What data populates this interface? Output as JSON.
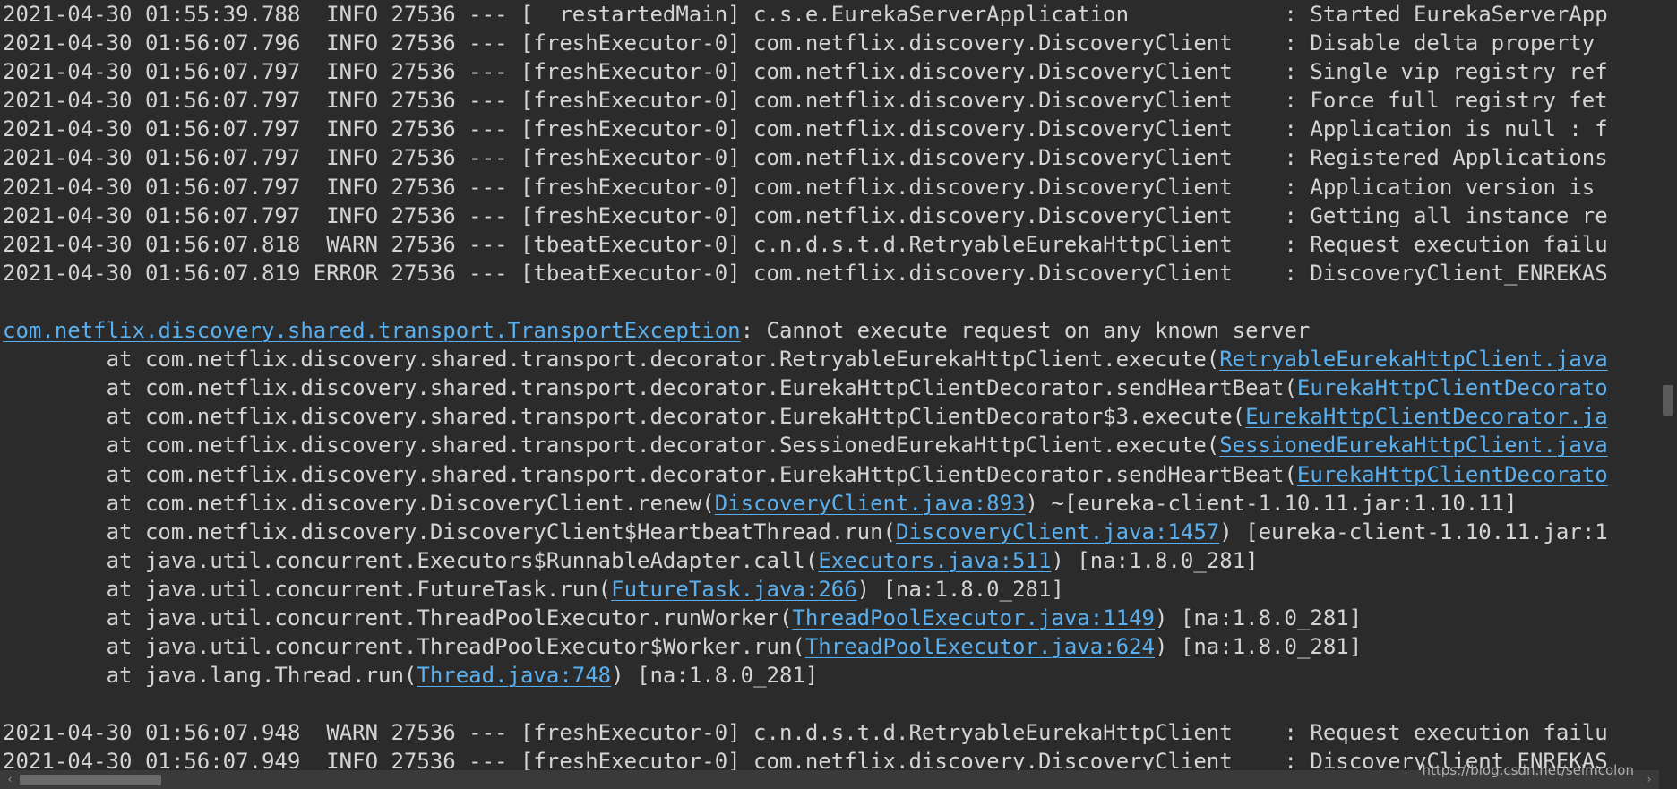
{
  "theme": {
    "background": "#2b2b2b",
    "text": "#d4d4d4",
    "link": "#5ab0ef"
  },
  "console": {
    "lines": [
      [
        {
          "t": "2021-04-30 01:55:39.788  INFO 27536 --- [  restartedMain] c.s.e.EurekaServerApplication            : Started EurekaServerApp"
        }
      ],
      [
        {
          "t": "2021-04-30 01:56:07.796  INFO 27536 --- [freshExecutor-0] com.netflix.discovery.DiscoveryClient    : Disable delta property"
        }
      ],
      [
        {
          "t": "2021-04-30 01:56:07.797  INFO 27536 --- [freshExecutor-0] com.netflix.discovery.DiscoveryClient    : Single vip registry ref"
        }
      ],
      [
        {
          "t": "2021-04-30 01:56:07.797  INFO 27536 --- [freshExecutor-0] com.netflix.discovery.DiscoveryClient    : Force full registry fet"
        }
      ],
      [
        {
          "t": "2021-04-30 01:56:07.797  INFO 27536 --- [freshExecutor-0] com.netflix.discovery.DiscoveryClient    : Application is null : f"
        }
      ],
      [
        {
          "t": "2021-04-30 01:56:07.797  INFO 27536 --- [freshExecutor-0] com.netflix.discovery.DiscoveryClient    : Registered Applications"
        }
      ],
      [
        {
          "t": "2021-04-30 01:56:07.797  INFO 27536 --- [freshExecutor-0] com.netflix.discovery.DiscoveryClient    : Application version is"
        }
      ],
      [
        {
          "t": "2021-04-30 01:56:07.797  INFO 27536 --- [freshExecutor-0] com.netflix.discovery.DiscoveryClient    : Getting all instance re"
        }
      ],
      [
        {
          "t": "2021-04-30 01:56:07.818  WARN 27536 --- [tbeatExecutor-0] c.n.d.s.t.d.RetryableEurekaHttpClient    : Request execution failu"
        }
      ],
      [
        {
          "t": "2021-04-30 01:56:07.819 ERROR 27536 --- [tbeatExecutor-0] com.netflix.discovery.DiscoveryClient    : DiscoveryClient_ENREKAS"
        }
      ],
      [
        {
          "t": ""
        }
      ],
      [
        {
          "t": "com.netflix.discovery.shared.transport.TransportException",
          "link": true
        },
        {
          "t": ": Cannot execute request on any known server"
        }
      ],
      [
        {
          "t": "        at com.netflix.discovery.shared.transport.decorator.RetryableEurekaHttpClient.execute("
        },
        {
          "t": "RetryableEurekaHttpClient.java",
          "link": true
        }
      ],
      [
        {
          "t": "        at com.netflix.discovery.shared.transport.decorator.EurekaHttpClientDecorator.sendHeartBeat("
        },
        {
          "t": "EurekaHttpClientDecorato",
          "link": true
        }
      ],
      [
        {
          "t": "        at com.netflix.discovery.shared.transport.decorator.EurekaHttpClientDecorator$3.execute("
        },
        {
          "t": "EurekaHttpClientDecorator.ja",
          "link": true
        }
      ],
      [
        {
          "t": "        at com.netflix.discovery.shared.transport.decorator.SessionedEurekaHttpClient.execute("
        },
        {
          "t": "SessionedEurekaHttpClient.java",
          "link": true
        }
      ],
      [
        {
          "t": "        at com.netflix.discovery.shared.transport.decorator.EurekaHttpClientDecorator.sendHeartBeat("
        },
        {
          "t": "EurekaHttpClientDecorato",
          "link": true
        }
      ],
      [
        {
          "t": "        at com.netflix.discovery.DiscoveryClient.renew("
        },
        {
          "t": "DiscoveryClient.java:893",
          "link": true
        },
        {
          "t": ") ~[eureka-client-1.10.11.jar:1.10.11]"
        }
      ],
      [
        {
          "t": "        at com.netflix.discovery.DiscoveryClient$HeartbeatThread.run("
        },
        {
          "t": "DiscoveryClient.java:1457",
          "link": true
        },
        {
          "t": ") [eureka-client-1.10.11.jar:1"
        }
      ],
      [
        {
          "t": "        at java.util.concurrent.Executors$RunnableAdapter.call("
        },
        {
          "t": "Executors.java:511",
          "link": true
        },
        {
          "t": ") [na:1.8.0_281]"
        }
      ],
      [
        {
          "t": "        at java.util.concurrent.FutureTask.run("
        },
        {
          "t": "FutureTask.java:266",
          "link": true
        },
        {
          "t": ") [na:1.8.0_281]"
        }
      ],
      [
        {
          "t": "        at java.util.concurrent.ThreadPoolExecutor.runWorker("
        },
        {
          "t": "ThreadPoolExecutor.java:1149",
          "link": true
        },
        {
          "t": ") [na:1.8.0_281]"
        }
      ],
      [
        {
          "t": "        at java.util.concurrent.ThreadPoolExecutor$Worker.run("
        },
        {
          "t": "ThreadPoolExecutor.java:624",
          "link": true
        },
        {
          "t": ") [na:1.8.0_281]"
        }
      ],
      [
        {
          "t": "        at java.lang.Thread.run("
        },
        {
          "t": "Thread.java:748",
          "link": true
        },
        {
          "t": ") [na:1.8.0_281]"
        }
      ],
      [
        {
          "t": ""
        }
      ],
      [
        {
          "t": "2021-04-30 01:56:07.948  WARN 27536 --- [freshExecutor-0] c.n.d.s.t.d.RetryableEurekaHttpClient    : Request execution failu"
        }
      ],
      [
        {
          "t": "2021-04-30 01:56:07.949  INFO 27536 --- [freshExecutor-0] com.netflix.discovery.DiscoveryClient    : DiscoveryClient_ENREKAS"
        }
      ]
    ]
  },
  "scrollbars": {
    "vertical_position": 0.52,
    "horizontal_position": 0.0
  },
  "watermark": {
    "text": "https://blog.csdn.net/seimcolon"
  }
}
